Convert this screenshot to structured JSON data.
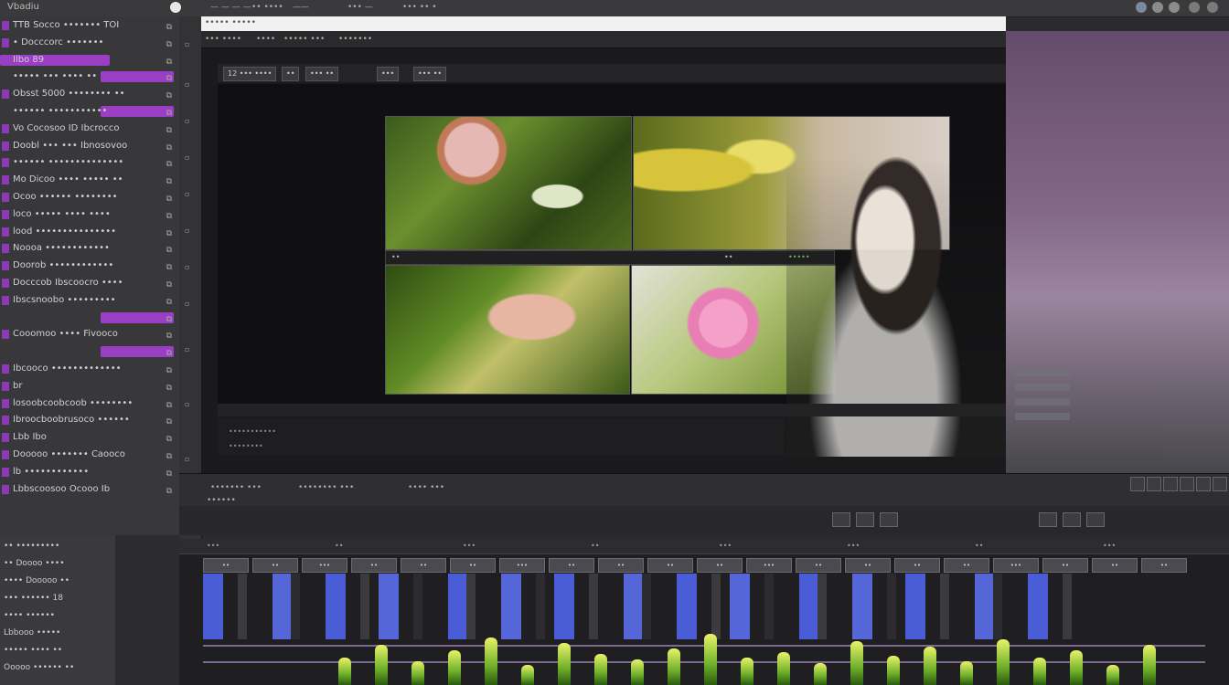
{
  "window": {
    "title": "Vbadiu",
    "menu": [
      "— — — —",
      "•• ••••",
      "——",
      "••• —",
      "••• •• •"
    ]
  },
  "left_panel": {
    "rows": [
      {
        "label": "TTB Socco ••••••• TOI",
        "bar": false
      },
      {
        "label": "• Docccorc •••••••",
        "bar": false
      },
      {
        "label": "Ilbo  89",
        "bar": true
      },
      {
        "label": "••••• ••• •••• ••",
        "bar": true
      },
      {
        "label": "Obsst   5000  •••••••• ••",
        "bar": false
      },
      {
        "label": "•••••• •••••••••••",
        "bar": true
      },
      {
        "label": "Vo Cocosoo  ID Ibcrocco",
        "bar": false
      },
      {
        "label": "Doobl ••• ••• Ibnosovoo",
        "bar": false
      },
      {
        "label": "••••••  ••••••••••••••",
        "bar": false
      },
      {
        "label": "Mo Dicoo •••• ••••• ••",
        "bar": false
      },
      {
        "label": "Ocoo •••••• ••••••••",
        "bar": false
      },
      {
        "label": "loco ••••• •••• ••••",
        "bar": false
      },
      {
        "label": "lood •••••••••••••••",
        "bar": false
      },
      {
        "label": "Noooa ••••••••••••",
        "bar": false
      },
      {
        "label": "Doorob ••••••••••••",
        "bar": false
      },
      {
        "label": "Docccob Ibscoocro ••••",
        "bar": false
      },
      {
        "label": "Ibscsnoobo •••••••••",
        "bar": false
      },
      {
        "label": "",
        "bar": true
      },
      {
        "label": "Cooomoo ••••  Fivooco",
        "bar": false
      },
      {
        "label": "",
        "bar": true
      },
      {
        "label": "Ibcooco •••••••••••••",
        "bar": false
      },
      {
        "label": "br",
        "bar": false
      },
      {
        "label": "losoobcoobcoob ••••••••",
        "bar": false
      },
      {
        "label": "Ibroocboobrusoco ••••••",
        "bar": false
      },
      {
        "label": "Lbb Ibo",
        "bar": false
      },
      {
        "label": "Dooooo ••••••• Caooco",
        "bar": false
      },
      {
        "label": "lb ••••••••••••",
        "bar": false
      },
      {
        "label": "Lbbscoosoo Ocooo  Ib",
        "bar": false
      }
    ]
  },
  "bottom_left": {
    "rows": [
      "•• •••••••••",
      "•• Doooo ••••",
      "•••• Dooooo ••",
      "••• •••••• 18",
      "•••• ••••••",
      "Lbbooo •••••",
      "••••• •••• ••",
      "Ooooo •••••• ••"
    ]
  },
  "viewer": {
    "url": "••••• •••••",
    "tabs": [
      "••• ••••",
      "••••",
      "••••• •••",
      "•••••••"
    ],
    "tools": [
      "12 ••• ••••",
      "••",
      "••• ••",
      "•••",
      "••• ••"
    ],
    "mid_marks": [
      "••",
      "••",
      "•••••"
    ],
    "bottom_labels": [
      "•••••••••••",
      "••••••••"
    ]
  },
  "transport": {
    "labels": [
      "••••••• •••",
      "•••••••• •••",
      "•••• •••",
      "••••••"
    ]
  },
  "timeline": {
    "ruler_ticks": [
      "•••",
      "••",
      "•••",
      "••",
      "•••",
      "•••",
      "••",
      "•••"
    ],
    "clips": [
      "••",
      "••",
      "•••",
      "••",
      "••",
      "••",
      "•••",
      "••",
      "••",
      "••",
      "••",
      "•••",
      "••",
      "••",
      "••",
      "••",
      "•••",
      "••",
      "••",
      "••"
    ]
  },
  "colors": {
    "accent": "#9a3fc4",
    "panel": "#38383b",
    "timeline_clip_blue": "#4a5cd6"
  }
}
